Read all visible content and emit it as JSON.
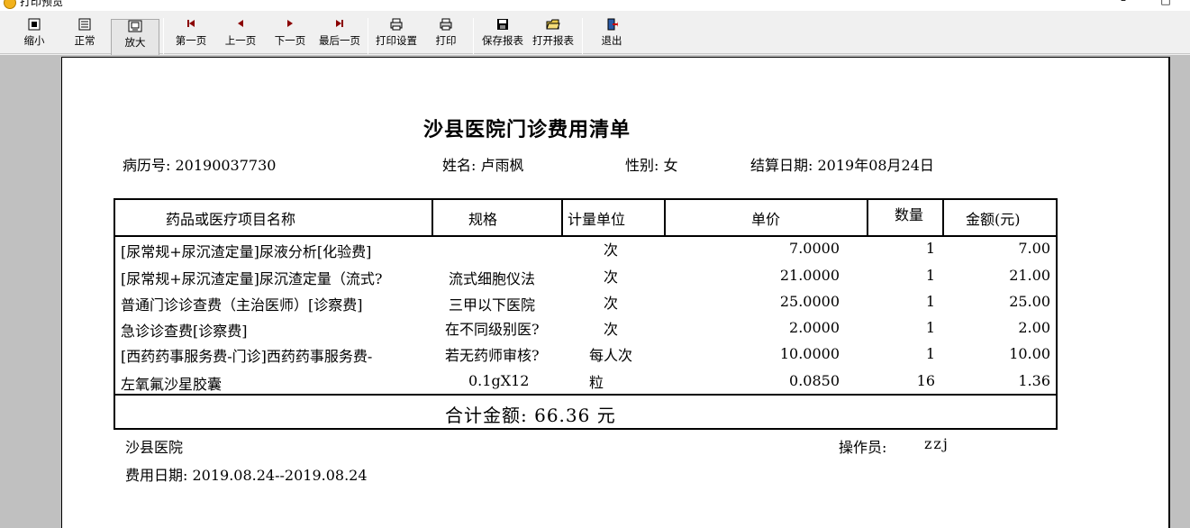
{
  "window": {
    "title": "打印预览"
  },
  "toolbar": {
    "buttons": [
      {
        "label": "缩小",
        "icon": "zoom-out-icon"
      },
      {
        "label": "正常",
        "icon": "normal-view-icon"
      },
      {
        "label": "放大",
        "icon": "zoom-in-icon"
      },
      {
        "label": "第一页",
        "icon": "first-page-icon"
      },
      {
        "label": "上一页",
        "icon": "prev-page-icon"
      },
      {
        "label": "下一页",
        "icon": "next-page-icon"
      },
      {
        "label": "最后一页",
        "icon": "last-page-icon"
      },
      {
        "label": "打印设置",
        "icon": "print-setup-icon"
      },
      {
        "label": "打印",
        "icon": "printer-icon"
      },
      {
        "label": "保存报表",
        "icon": "save-icon"
      },
      {
        "label": "打开报表",
        "icon": "open-folder-icon"
      },
      {
        "label": "退出",
        "icon": "exit-icon"
      }
    ]
  },
  "report": {
    "title": "沙县医院门诊费用清单",
    "record_no": "病历号: 20190037730",
    "name": "姓名: 卢雨枫",
    "gender": "性别: 女",
    "settle_date": "结算日期: 2019年08月24日",
    "columns": [
      "药品或医疗项目名称",
      "规格",
      "计量单位",
      "单价",
      "数量",
      "金额(元)"
    ],
    "rows": [
      [
        "[尿常规+尿沉渣定量]尿液分析[化验费]",
        "",
        "次",
        "7.0000",
        "1",
        "7.00"
      ],
      [
        "[尿常规+尿沉渣定量]尿沉渣定量（流式?",
        "流式细胞仪法",
        "次",
        "21.0000",
        "1",
        "21.00"
      ],
      [
        "普通门诊诊查费（主治医师）[诊察费]",
        "三甲以下医院",
        "次",
        "25.0000",
        "1",
        "25.00"
      ],
      [
        "急诊诊查费[诊察费]",
        "在不同级别医?",
        "次",
        "2.0000",
        "1",
        "2.00"
      ],
      [
        "[西药药事服务费-门诊]西药药事服务费-",
        "若无药师审核?",
        "每人次",
        "10.0000",
        "1",
        "10.00"
      ],
      [
        "左氧氟沙星胶囊",
        "0.1gX12",
        "粒",
        "0.0850",
        "16",
        "1.36"
      ]
    ],
    "total": "合计金额: 66.36  元",
    "hospital": "沙县医院",
    "operator_label": "操作员:",
    "operator": "zzj",
    "fee_date": "费用日期: 2019.08.24--2019.08.24"
  }
}
